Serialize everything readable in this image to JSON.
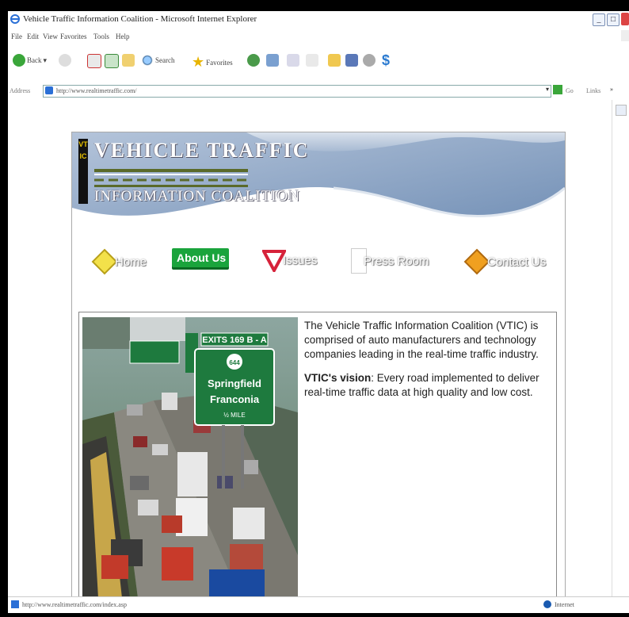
{
  "window": {
    "title": "Vehicle Traffic Information Coalition - Microsoft Internet Explorer",
    "minimize_label": "_",
    "maximize_label": "□"
  },
  "menu": [
    "File",
    "Edit",
    "View",
    "Favorites",
    "Tools",
    "Help"
  ],
  "toolbar": {
    "back_label": "Back",
    "search_label": "Search",
    "favorites_label": "Favorites"
  },
  "address": {
    "label": "Address",
    "url": "http://www.realtimetraffic.com/",
    "go_label": "Go",
    "links_label": "Links"
  },
  "site": {
    "logo_line1": "VEHICLE TRAFFIC",
    "logo_line2": "INFORMATION COALITION",
    "logo_vertical": "VTIC",
    "nav": [
      "Home",
      "About Us",
      "Issues",
      "Press Room",
      "Contact Us"
    ],
    "sign": {
      "exit": "EXITS 169 B - A",
      "route": "644",
      "line1": "Springfield",
      "line2": "Franconia",
      "line3": "½ MILE"
    },
    "intro": "The Vehicle Traffic Information Coalition (VTIC) is comprised of auto manufacturers and technology companies leading in the real-time traffic industry.",
    "vision_label": "VTIC's vision",
    "vision_text": ": Every road implemented to deliver real-time traffic data at high quality and low cost."
  },
  "status": {
    "url": "http://www.realtimetraffic.com/index.asp",
    "zone": "Internet"
  },
  "colors": {
    "about_green": "#1aa43c",
    "banner_blue": "#8fa8c8",
    "sign_green": "#1e7a3e"
  }
}
